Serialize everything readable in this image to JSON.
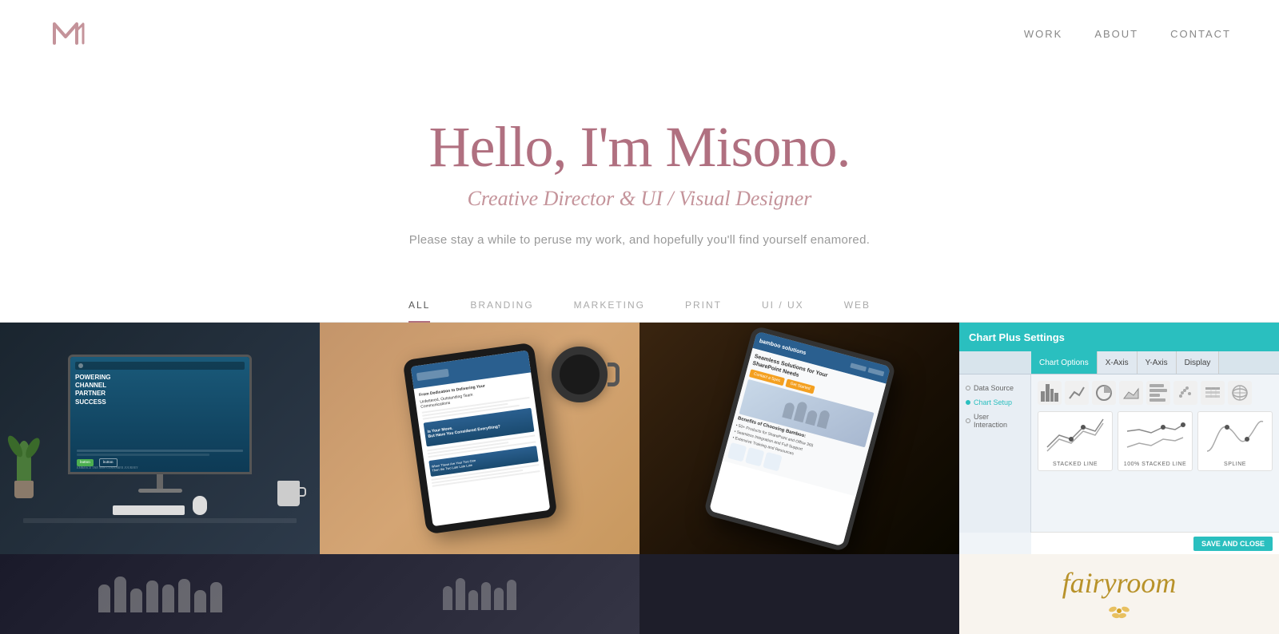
{
  "nav": {
    "logo_alt": "Misono Logo",
    "links": [
      {
        "label": "WORK",
        "href": "#work"
      },
      {
        "label": "ABOUT",
        "href": "#about"
      },
      {
        "label": "CONTACT",
        "href": "#contact"
      }
    ]
  },
  "hero": {
    "title": "Hello, I'm Misono.",
    "subtitle": "Creative Director & UI / Visual Designer",
    "description": "Please stay a while to peruse my work, and hopefully you'll find yourself enamored."
  },
  "filter": {
    "tabs": [
      {
        "label": "ALL",
        "active": true
      },
      {
        "label": "BRANDING",
        "active": false
      },
      {
        "label": "MARKETING",
        "active": false
      },
      {
        "label": "PRINT",
        "active": false
      },
      {
        "label": "UI / UX",
        "active": false
      },
      {
        "label": "WEB",
        "active": false
      }
    ]
  },
  "portfolio": {
    "tile1_alt": "Powering Channel Partner Success - iMac Mockup",
    "tile2_alt": "Marketing Document - Tablet Mockup",
    "tile3_alt": "Bamboo Solutions SharePoint - iPad Mockup",
    "tile4_alt": "Chart Plus Settings UI",
    "tile5_alt": "People meeting",
    "tile6_alt": "Fairy Room logo"
  },
  "chart_ui": {
    "title": "Chart Plus Settings",
    "tabs": [
      "Chart Options",
      "X-Axis",
      "Y-Axis",
      "Display"
    ],
    "sidebar_items": [
      "Data Source",
      "Chart Setup",
      "User Interaction"
    ],
    "chart_types": [
      "columns",
      "line",
      "pie",
      "area",
      "bar",
      "scatter",
      "table"
    ],
    "line_types": [
      "STACKED LINE",
      "100% STACKED LINE",
      "SPLINE"
    ],
    "save_label": "SAVE AND CLOSE"
  },
  "fairy": {
    "text": "fairyroom"
  },
  "ipad_content": {
    "logo": "bamboo solutions",
    "heading": "Seamless Solutions for Your SharePoint Needs",
    "cta": "Contact a Spec",
    "benefits_title": "Benefits of Choosing Bamboo",
    "sub1": "50+ Products for SharePoint and Office 365",
    "sub2": "Seamless Integration and Full Support",
    "sub3": "Extensive Training and Resources"
  }
}
